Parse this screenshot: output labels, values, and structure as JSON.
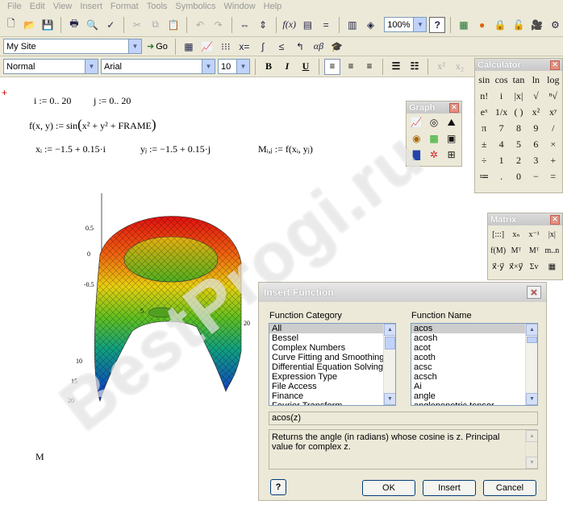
{
  "menu": [
    "File",
    "Edit",
    "View",
    "Insert",
    "Format",
    "Tools",
    "Symbolics",
    "Window",
    "Help"
  ],
  "toolbar": {
    "zoom": "100%",
    "site": "My Site",
    "go_label": "Go",
    "style": "Normal",
    "font": "Arial",
    "size": "10",
    "bold": "B",
    "italic": "I",
    "underline": "U"
  },
  "worksheet": {
    "range_i": "i := 0.. 20",
    "range_j": "j := 0.. 20",
    "func_lhs": "f(x, y) := sin",
    "func_arg": "x² + y² + FRAME",
    "xi": "xᵢ := −1.5 + 0.15·i",
    "yj": "yⱼ := −1.5 + 0.15·j",
    "mij": "Mᵢ,ⱼ := f(xᵢ, yⱼ)",
    "matrix_label": "M",
    "axis_labels": [
      "0.5",
      "0",
      "-0.5",
      "5",
      "10",
      "15",
      "20",
      "20"
    ]
  },
  "calculator": {
    "title": "Calculator",
    "buttons": [
      "sin",
      "cos",
      "tan",
      "ln",
      "log",
      "n!",
      "i",
      "|x|",
      "√",
      "ⁿ√",
      "eˣ",
      "1/x",
      "( )",
      "x²",
      "xʸ",
      "π",
      "7",
      "8",
      "9",
      "/",
      "±",
      "4",
      "5",
      "6",
      "×",
      "÷",
      "1",
      "2",
      "3",
      "+",
      "≔",
      ".",
      "0",
      "−",
      "="
    ]
  },
  "graph": {
    "title": "Graph",
    "icons": [
      "xy-plot-icon",
      "polar-plot-icon",
      "surface-plot-icon",
      "contour-plot-icon",
      "3d-bar-icon",
      "3d-scatter-icon",
      "vector-field-icon",
      "zoom-icon",
      "trace-icon"
    ]
  },
  "matrix": {
    "title": "Matrix",
    "buttons": [
      "[:::]",
      "xₙ",
      "x⁻¹",
      "|x|",
      "f(M)",
      "Mᵀ",
      "Mᵀ",
      "m..n",
      "x⃗·y⃗",
      "x⃗×y⃗",
      "Σv",
      "▦"
    ]
  },
  "dialog": {
    "title": "Insert Function",
    "category_label": "Function Category",
    "name_label": "Function Name",
    "categories": [
      "All",
      "Bessel",
      "Complex Numbers",
      "Curve Fitting and Smoothing",
      "Differential Equation Solving",
      "Expression Type",
      "File Access",
      "Finance",
      "Fourier Transform"
    ],
    "functions": [
      "acos",
      "acosh",
      "acot",
      "acoth",
      "acsc",
      "acsch",
      "Ai",
      "angle",
      "anglepenetric tensor"
    ],
    "signature": "acos(z)",
    "description": "Returns the angle (in radians) whose cosine is z. Principal value for complex z.",
    "ok": "OK",
    "insert": "Insert",
    "cancel": "Cancel",
    "help": "?"
  },
  "watermark": "BestProgi.ru"
}
